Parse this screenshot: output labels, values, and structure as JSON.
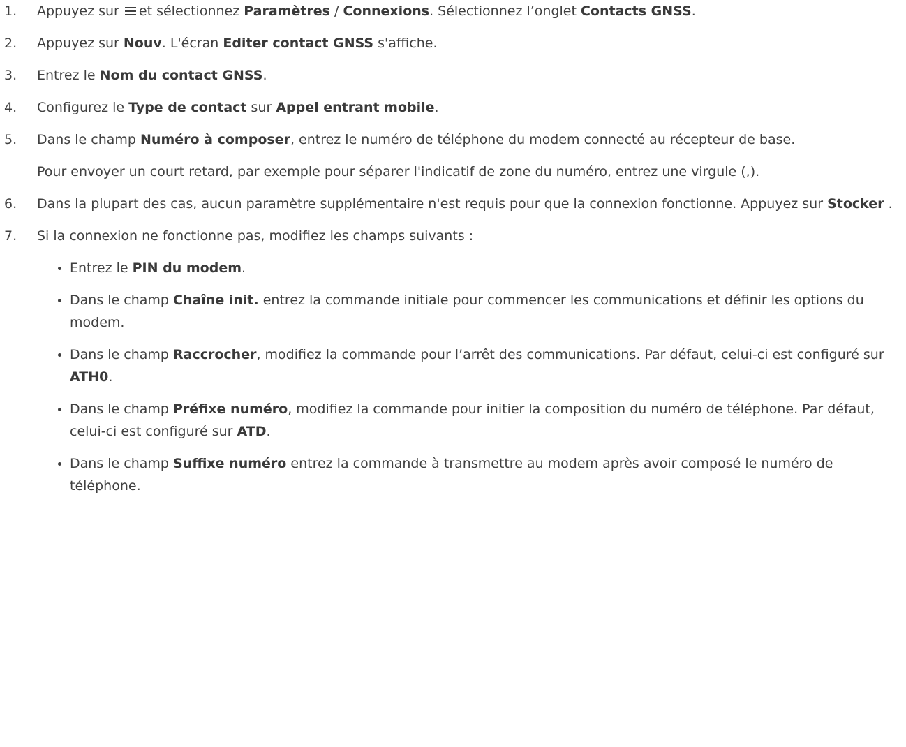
{
  "steps": [
    {
      "num": "1.",
      "a": "Appuyez sur",
      "b": "et sélectionnez",
      "bold1": "Paramètres",
      "c": " / ",
      "bold2": "Connexions",
      "d": ". Sélectionnez l’onglet ",
      "bold3": "Contacts GNSS",
      "e": "."
    },
    {
      "num": "2.",
      "a": "Appuyez sur ",
      "bold1": "Nouv",
      "b": ". L'écran ",
      "bold2": "Editer contact GNSS",
      "c": " s'affiche."
    },
    {
      "num": "3.",
      "a": "Entrez le ",
      "bold1": "Nom du contact GNSS",
      "b": "."
    },
    {
      "num": "4.",
      "a": "Configurez le ",
      "bold1": "Type de contact",
      "b": " sur ",
      "bold2": "Appel entrant mobile",
      "c": "."
    },
    {
      "num": "5.",
      "a": "Dans le champ ",
      "bold1": "Numéro à composer",
      "b": ", entrez le numéro de téléphone du modem connecté au récepteur de base.",
      "note": "Pour envoyer un court retard, par exemple pour séparer l'indicatif de zone du numéro, entrez une virgule (,)."
    },
    {
      "num": "6.",
      "a": "Dans la plupart des cas, aucun paramètre supplémentaire n'est requis pour que la connexion fonctionne. Appuyez sur ",
      "bold1": "Stocker",
      "b": " ."
    },
    {
      "num": "7.",
      "a": "Si la connexion ne fonctionne pas, modifiez les champs suivants :",
      "sub": [
        {
          "a": "Entrez le ",
          "bold1": "PIN du modem",
          "b": "."
        },
        {
          "a": "Dans le champ ",
          "bold1": "Chaîne init.",
          "b": " entrez la commande initiale pour commencer les communications et définir les options du modem."
        },
        {
          "a": "Dans le champ ",
          "bold1": "Raccrocher",
          "b": ", modifiez la commande pour l’arrêt des communications. Par défaut, celui-ci est configuré sur ",
          "bold2": "ATH0",
          "c": "."
        },
        {
          "a": "Dans le champ ",
          "bold1": "Préfixe numéro",
          "b": ", modifiez la commande pour initier la composition du numéro de téléphone. Par défaut, celui-ci est configuré sur ",
          "bold2": "ATD",
          "c": "."
        },
        {
          "a": "Dans le champ ",
          "bold1": "Suffixe numéro",
          "b": " entrez la commande à transmettre au modem après avoir composé le numéro de téléphone."
        }
      ]
    }
  ]
}
